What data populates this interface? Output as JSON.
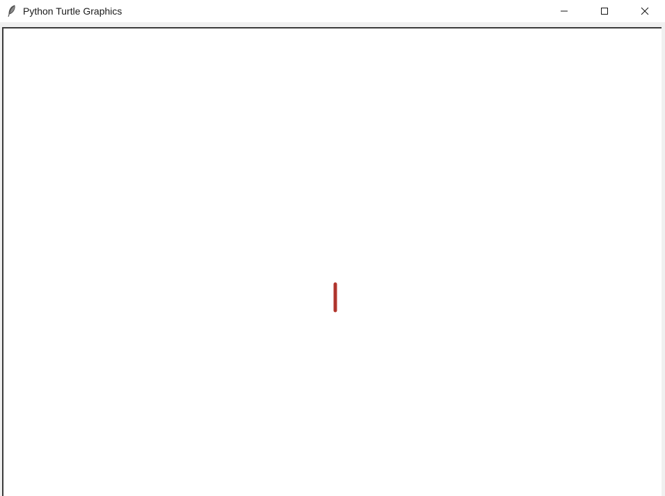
{
  "window": {
    "title": "Python Turtle Graphics",
    "icon": "feather-icon"
  },
  "controls": {
    "minimize_icon": "minimize-icon",
    "maximize_icon": "maximize-icon",
    "close_icon": "close-icon"
  },
  "canvas": {
    "background": "#ffffff",
    "drawing": {
      "stroke_color": "#b5372f",
      "shape": "vertical line"
    }
  }
}
